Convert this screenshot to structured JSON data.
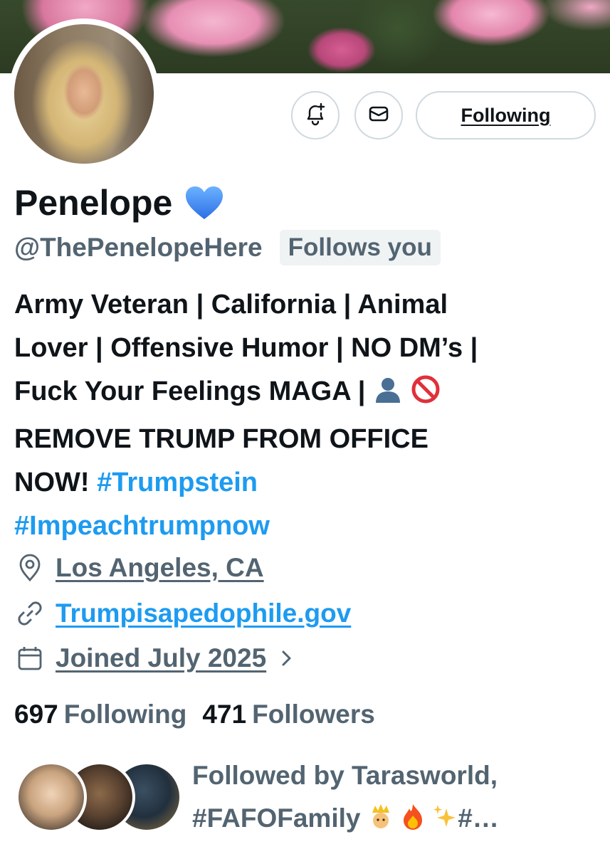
{
  "profile": {
    "display_name": "Penelope",
    "verified_emoji": "blue-heart",
    "handle": "@ThePenelopeHere",
    "follows_you": "Follows you",
    "bio": {
      "line1": "Army Veteran | California | Animal",
      "line2": "Lover | Offensive Humor | NO DM’s |",
      "line3": "Fuck Your Feelings MAGA |",
      "line4": "REMOVE TRUMP FROM OFFICE",
      "line5_text": "NOW! ",
      "hashtag1": "#Trumpstein",
      "hashtag2": "#Impeachtrumpnow"
    },
    "location": "Los Angeles, CA",
    "website": "Trumpisapedophile.gov",
    "joined": "Joined July 2025"
  },
  "actions": {
    "notify_icon": "bell-plus-icon",
    "message_icon": "envelope-icon",
    "follow_label": "Following"
  },
  "stats": {
    "following_count": "697",
    "following_label": "Following",
    "followers_count": "471",
    "followers_label": "Followers"
  },
  "followed_by": {
    "line1": "Followed by Tarasworld,",
    "line2_text": "#FAFOFamily",
    "line2_suffix": "#…"
  },
  "colors": {
    "text_primary": "#0f1419",
    "text_secondary": "#536471",
    "link_blue": "#1d9bf0",
    "badge_bg": "#eff3f4",
    "border": "#cfd9de"
  }
}
